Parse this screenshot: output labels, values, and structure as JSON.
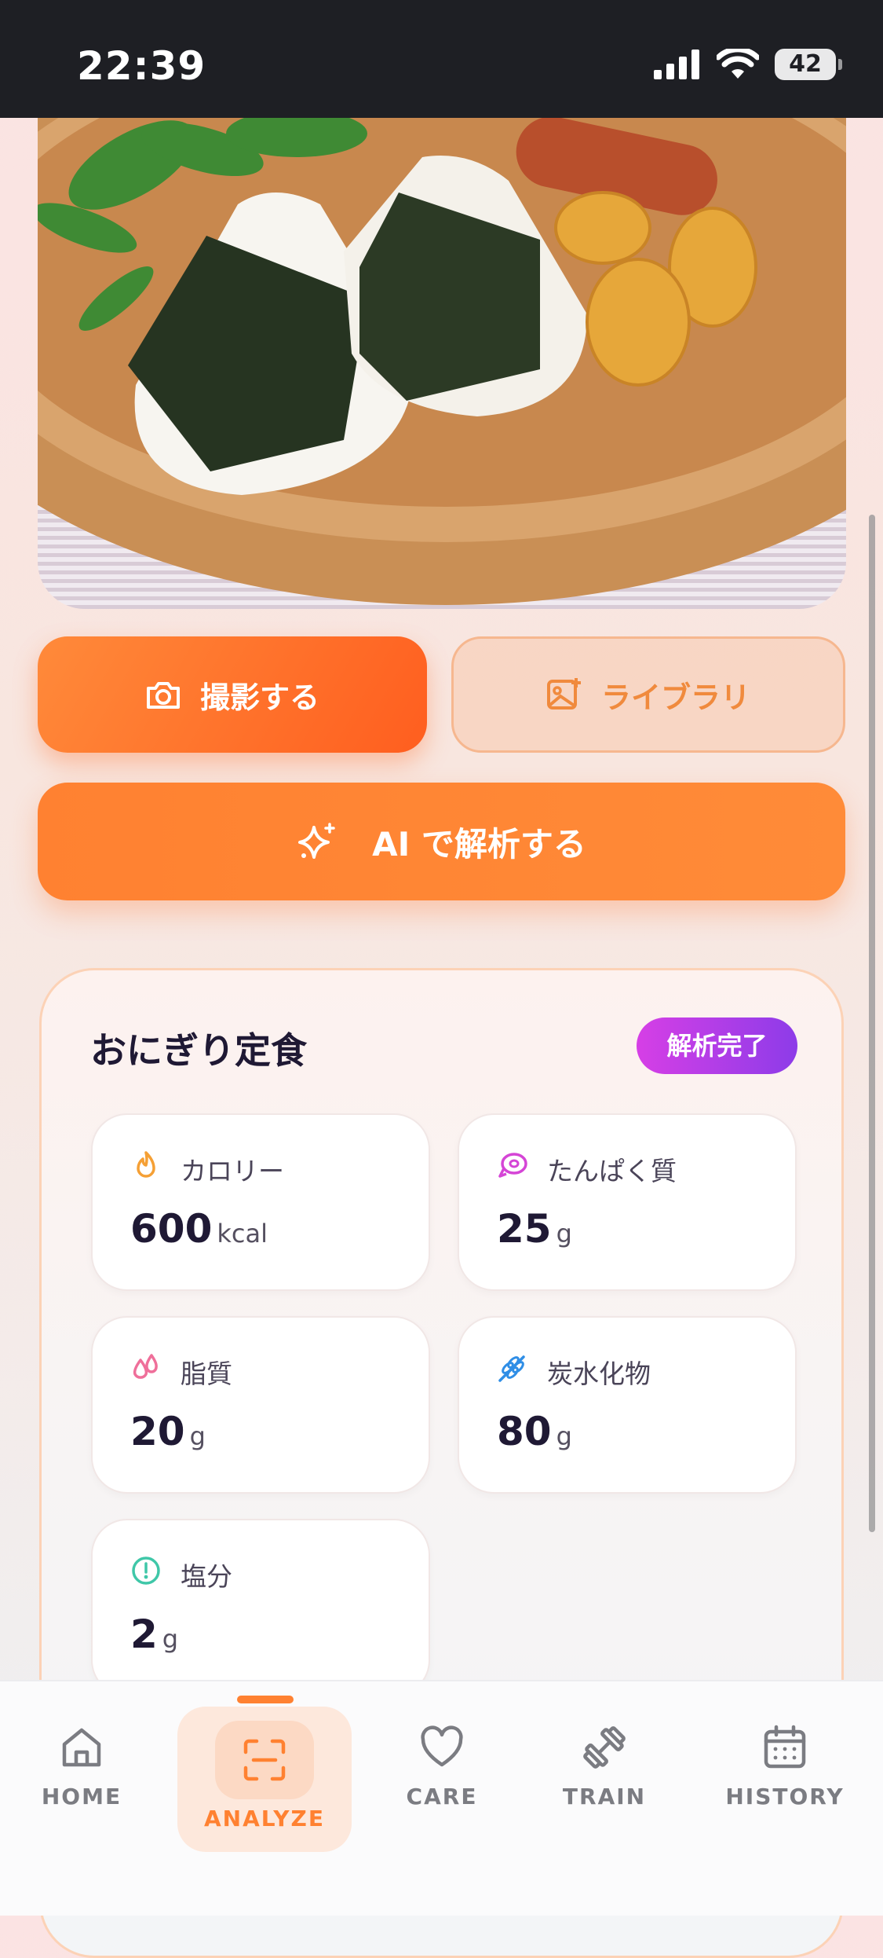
{
  "status_bar": {
    "time": "22:39",
    "battery": "42"
  },
  "actions": {
    "camera_label": "撮影する",
    "library_label": "ライブラリ",
    "analyze_label": "AI で解析する"
  },
  "result": {
    "title": "おにぎり定食",
    "status_badge": "解析完了",
    "metrics": [
      {
        "label": "カロリー",
        "value": "600",
        "unit": "kcal",
        "icon": "flame-icon",
        "color": "#f5a035"
      },
      {
        "label": "たんぱく質",
        "value": "25",
        "unit": "g",
        "icon": "meat-icon",
        "color": "#d545d6"
      },
      {
        "label": "脂質",
        "value": "20",
        "unit": "g",
        "icon": "droplets-icon",
        "color": "#ef6f9a"
      },
      {
        "label": "炭水化物",
        "value": "80",
        "unit": "g",
        "icon": "wheat-icon",
        "color": "#2f8ee6"
      },
      {
        "label": "塩分",
        "value": "2",
        "unit": "g",
        "icon": "alert-circle-icon",
        "color": "#3fc7a8"
      }
    ]
  },
  "nav": {
    "items": [
      {
        "label": "HOME",
        "icon": "home-icon"
      },
      {
        "label": "ANALYZE",
        "icon": "scan-icon",
        "active": true
      },
      {
        "label": "CARE",
        "icon": "heart-icon"
      },
      {
        "label": "TRAIN",
        "icon": "dumbbell-icon"
      },
      {
        "label": "HISTORY",
        "icon": "calendar-icon"
      }
    ],
    "active_color": "#ff8131"
  }
}
